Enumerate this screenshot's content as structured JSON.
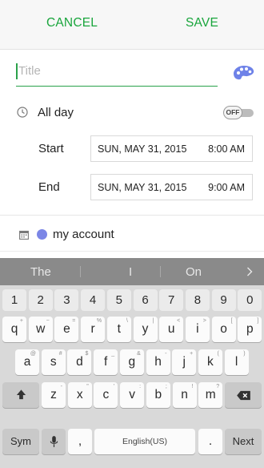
{
  "topbar": {
    "cancel": "CANCEL",
    "save": "SAVE"
  },
  "title": {
    "placeholder": "Title"
  },
  "allday": {
    "label": "All day",
    "toggle": "OFF"
  },
  "start": {
    "label": "Start",
    "date": "SUN, MAY 31, 2015",
    "time": "8:00 AM"
  },
  "end": {
    "label": "End",
    "date": "SUN, MAY 31, 2015",
    "time": "9:00 AM"
  },
  "account": {
    "name": "my account",
    "color": "#7b86e6"
  },
  "colors": {
    "accent": "#19a53c"
  },
  "keyboard": {
    "suggestions": [
      "The",
      "I",
      "On"
    ],
    "numbers": [
      "1",
      "2",
      "3",
      "4",
      "5",
      "6",
      "7",
      "8",
      "9",
      "0"
    ],
    "row1": [
      {
        "k": "q",
        "s": "+"
      },
      {
        "k": "w",
        "s": "−"
      },
      {
        "k": "e",
        "s": "="
      },
      {
        "k": "r",
        "s": "%"
      },
      {
        "k": "t",
        "s": "\\"
      },
      {
        "k": "y",
        "s": "|"
      },
      {
        "k": "u",
        "s": "<"
      },
      {
        "k": "i",
        "s": ">"
      },
      {
        "k": "o",
        "s": "["
      },
      {
        "k": "p",
        "s": "]"
      }
    ],
    "row2": [
      {
        "k": "a",
        "s": "@"
      },
      {
        "k": "s",
        "s": "#"
      },
      {
        "k": "d",
        "s": "$"
      },
      {
        "k": "f",
        "s": "_"
      },
      {
        "k": "g",
        "s": "&"
      },
      {
        "k": "h",
        "s": "-"
      },
      {
        "k": "j",
        "s": "+"
      },
      {
        "k": "k",
        "s": "("
      },
      {
        "k": "l",
        "s": ")"
      }
    ],
    "row3": [
      {
        "k": "z",
        "s": "-"
      },
      {
        "k": "x",
        "s": "\""
      },
      {
        "k": "c",
        "s": "'"
      },
      {
        "k": "v",
        "s": ":"
      },
      {
        "k": "b",
        "s": ";"
      },
      {
        "k": "n",
        "s": "!"
      },
      {
        "k": "m",
        "s": "?"
      }
    ],
    "sym": "Sym",
    "comma": ",",
    "space": "English(US)",
    "period": ".",
    "next": "Next"
  }
}
